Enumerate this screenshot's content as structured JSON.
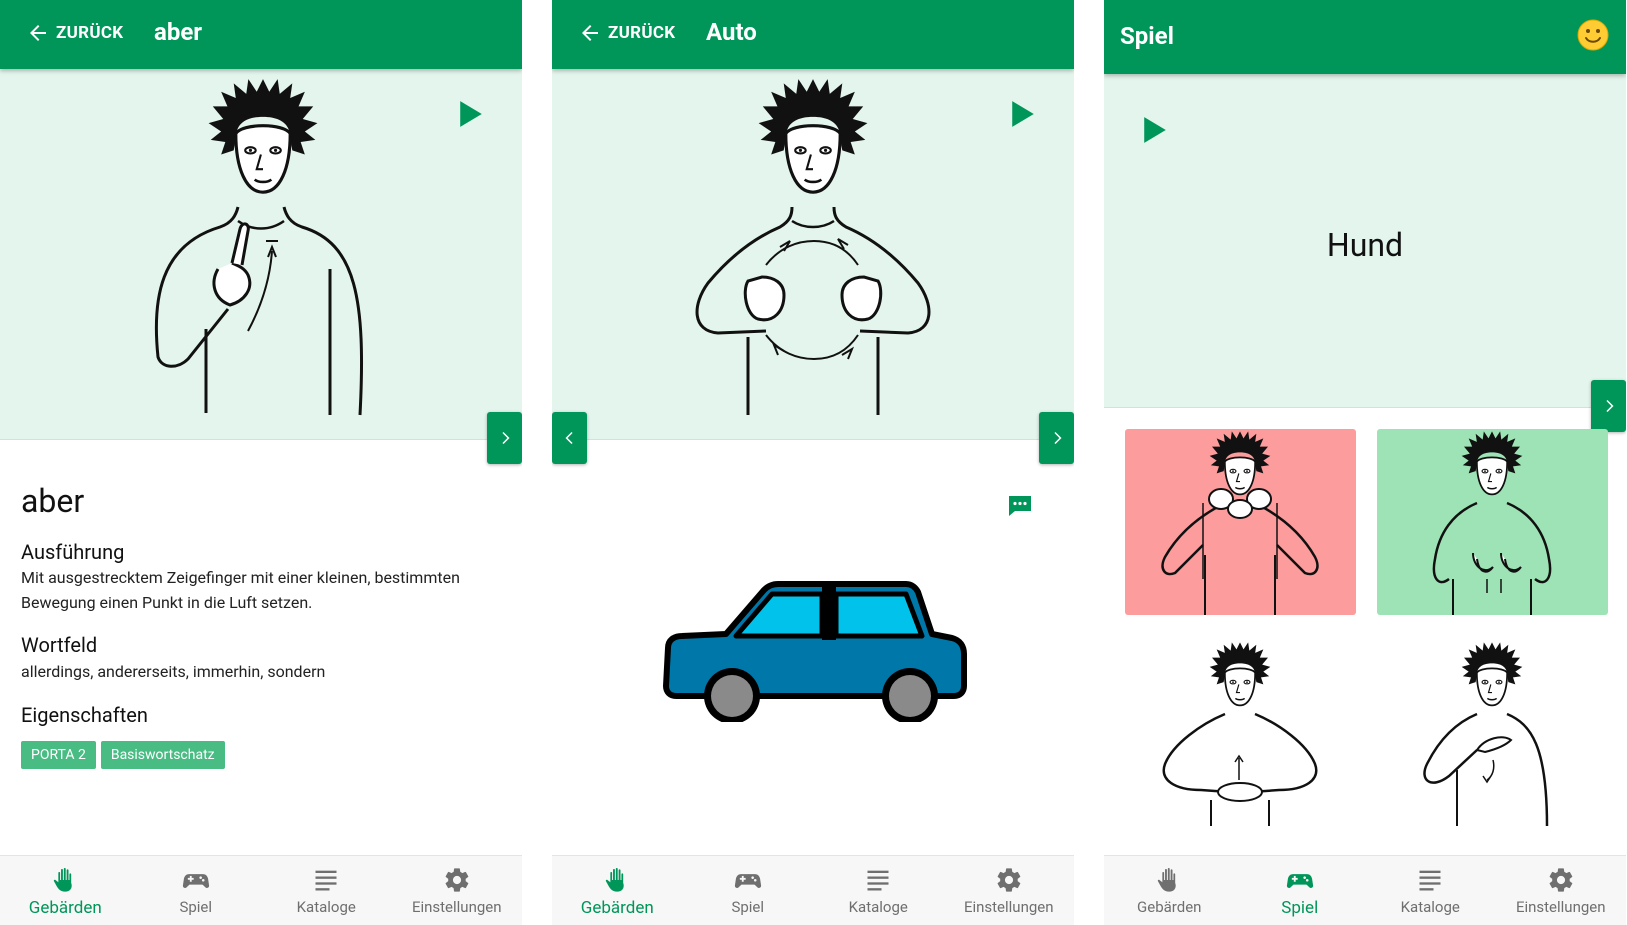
{
  "colors": {
    "primary": "#00965a",
    "light_bg": "#e3f5ec",
    "tag": "#49bc83",
    "wrong": "#fc9c9c",
    "correct": "#9ee3b5"
  },
  "screens": [
    {
      "back_label": "ZURÜCK",
      "title": "aber",
      "word": "aber",
      "sections": [
        {
          "heading": "Ausführung",
          "text": "Mit ausgestrecktem Zeigefinger mit einer kleinen, bestimmten Bewegung einen Punkt in die Luft setzen."
        },
        {
          "heading": "Wortfeld",
          "text": "allerdings, andererseits, immerhin, sondern"
        },
        {
          "heading": "Eigenschaften",
          "text": ""
        }
      ],
      "tags": [
        "PORTA 2",
        "Basiswortschatz"
      ]
    },
    {
      "back_label": "ZURÜCK",
      "title": "Auto"
    },
    {
      "title": "Spiel",
      "word": "Hund"
    }
  ],
  "bottom_nav": [
    {
      "label": "Gebärden",
      "icon": "hand-icon"
    },
    {
      "label": "Spiel",
      "icon": "gamepad-icon"
    },
    {
      "label": "Kataloge",
      "icon": "list-icon"
    },
    {
      "label": "Einstellungen",
      "icon": "gear-icon"
    }
  ]
}
